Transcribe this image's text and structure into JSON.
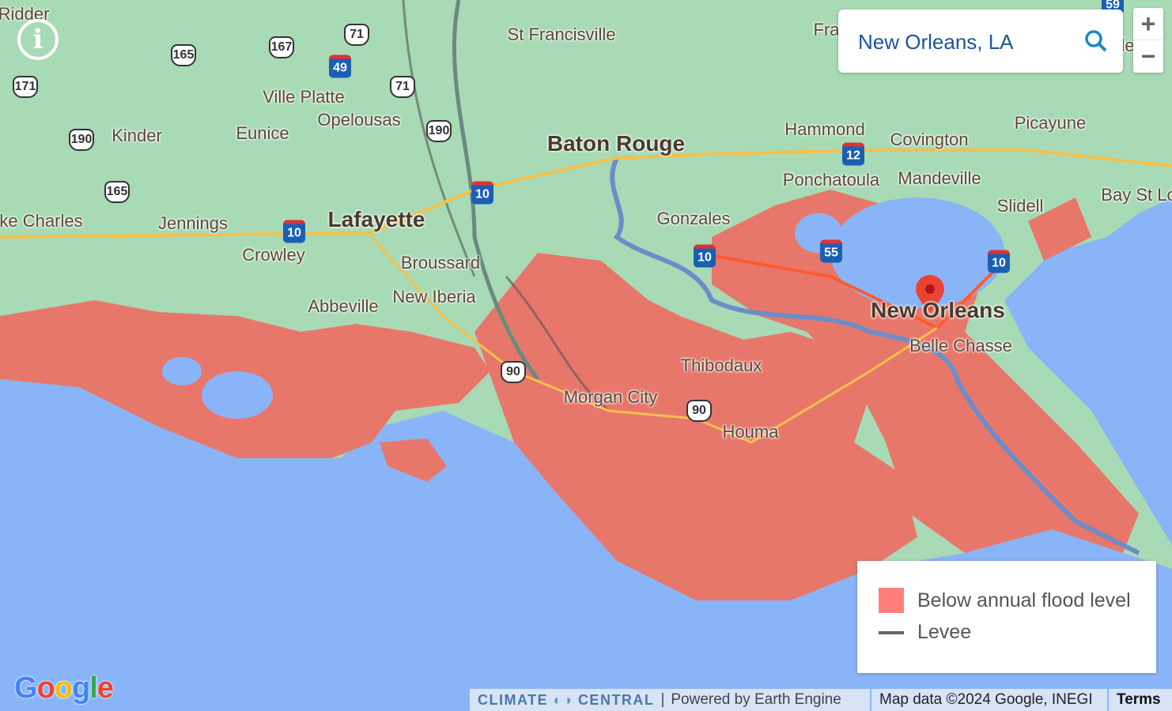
{
  "search": {
    "value": "New Orleans, LA",
    "icon": "search-icon"
  },
  "zoom": {
    "in": "+",
    "out": "−"
  },
  "info": {
    "label": "i"
  },
  "cities": [
    "Ridder",
    "St Francisville",
    "Ville Platte",
    "Opelousas",
    "Kinder",
    "Eunice",
    "Baton Rouge",
    "Hammond",
    "Covington",
    "Picayune",
    "Ponchatoula",
    "Mandeville",
    "Slidell",
    "Bay St Lo",
    "ke Charles",
    "Jennings",
    "Lafayette",
    "Crowley",
    "Broussard",
    "Gonzales",
    "Abbeville",
    "New Iberia",
    "New Orleans",
    "Belle Chasse",
    "Thibodaux",
    "Morgan City",
    "Houma",
    "Fra",
    "le"
  ],
  "shields": {
    "us": [
      "171",
      "165",
      "167",
      "71",
      "71",
      "190",
      "190",
      "165",
      "90",
      "90"
    ],
    "interstate": [
      "49",
      "10",
      "10",
      "10",
      "55",
      "12",
      "10",
      "59"
    ]
  },
  "legend": {
    "flood_label": "Below annual flood level",
    "levee_label": "Levee",
    "flood_color": "#ff7f7b",
    "levee_color": "#666666"
  },
  "footer": {
    "brand_left": "CLIMATE",
    "brand_right": "CENTRAL",
    "separator": "|",
    "powered": "Powered by Earth Engine",
    "map_data": "Map data ©2024 Google, INEGI",
    "terms": "Terms"
  },
  "google_logo": "Google",
  "colors": {
    "land": "#a8dab5",
    "water": "#8ab4f8",
    "flood": "#e8776b"
  }
}
